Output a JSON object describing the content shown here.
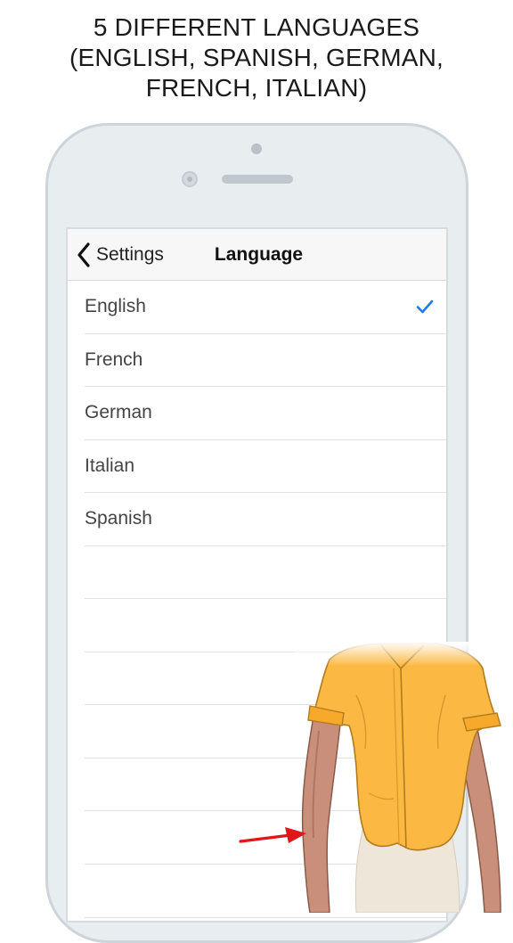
{
  "headline": {
    "line1": "5 DIFFERENT LANGUAGES",
    "line2": "(ENGLISH, SPANISH, GERMAN,",
    "line3": "FRENCH, ITALIAN)"
  },
  "navbar": {
    "back_label": "Settings",
    "title": "Language"
  },
  "languages": [
    {
      "label": "English",
      "selected": true
    },
    {
      "label": "French",
      "selected": false
    },
    {
      "label": "German",
      "selected": false
    },
    {
      "label": "Italian",
      "selected": false
    },
    {
      "label": "Spanish",
      "selected": false
    }
  ],
  "colors": {
    "accent": "#1e7cf2",
    "arrow": "#e0161a",
    "shirt": "#fbb943"
  },
  "icons": {
    "back": "chevron-left-icon",
    "check": "checkmark-icon",
    "arrow": "red-arrow-icon"
  }
}
